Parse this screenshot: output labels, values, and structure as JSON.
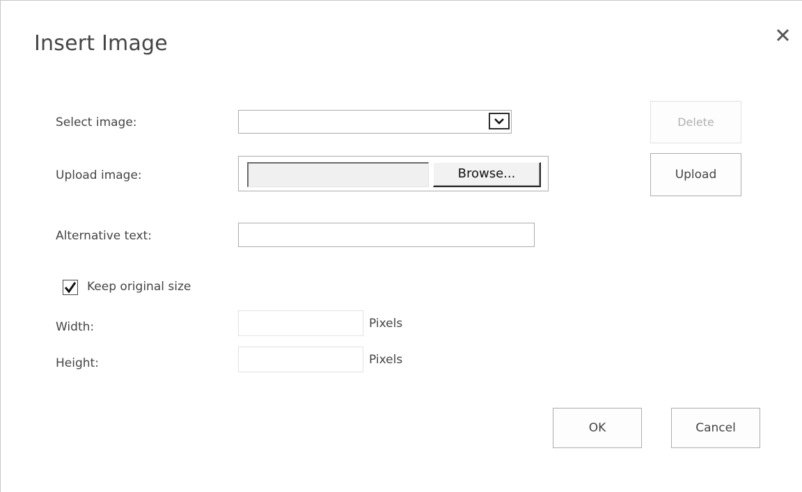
{
  "dialog": {
    "title": "Insert Image",
    "close_icon": "close-icon"
  },
  "form": {
    "select_image_label": "Select image:",
    "select_image_value": "",
    "delete_label": "Delete",
    "upload_image_label": "Upload image:",
    "browse_label": "Browse...",
    "upload_label": "Upload",
    "alt_text_label": "Alternative text:",
    "alt_text_value": "",
    "keep_size_label": "Keep original size",
    "keep_size_checked": true,
    "width_label": "Width:",
    "width_value": "",
    "width_unit": "Pixels",
    "height_label": "Height:",
    "height_value": "",
    "height_unit": "Pixels"
  },
  "footer": {
    "ok_label": "OK",
    "cancel_label": "Cancel"
  },
  "colors": {
    "text": "#444444",
    "border": "#ababab",
    "disabled_text": "#b1b1b1"
  }
}
